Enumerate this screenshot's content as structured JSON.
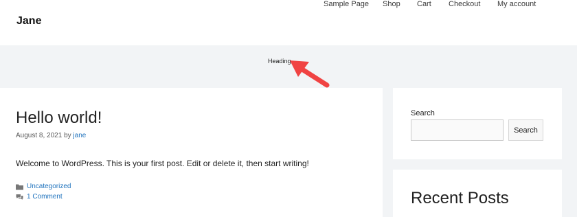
{
  "site": {
    "title": "Jane"
  },
  "nav": {
    "items": [
      {
        "label": "Sample Page"
      },
      {
        "label": "Shop"
      },
      {
        "label": "Cart"
      },
      {
        "label": "Checkout"
      },
      {
        "label": "My account"
      }
    ]
  },
  "heading_bar": {
    "text": "Heading"
  },
  "annotation": {
    "arrow_color": "#f04343"
  },
  "post": {
    "title": "Hello world!",
    "date": "August 8, 2021",
    "by": "by",
    "author": "jane",
    "body": "Welcome to WordPress. This is your first post. Edit or delete it, then start writing!",
    "category": "Uncategorized",
    "comments": "1 Comment",
    "category_icon": "folder-icon",
    "comments_icon": "comments-icon"
  },
  "sidebar": {
    "search": {
      "label": "Search",
      "placeholder": "",
      "value": "",
      "button_label": "Search"
    },
    "recent_posts": {
      "title": "Recent Posts"
    }
  },
  "colors": {
    "link": "#1e72bd",
    "background": "#f2f4f6",
    "card": "#ffffff"
  }
}
